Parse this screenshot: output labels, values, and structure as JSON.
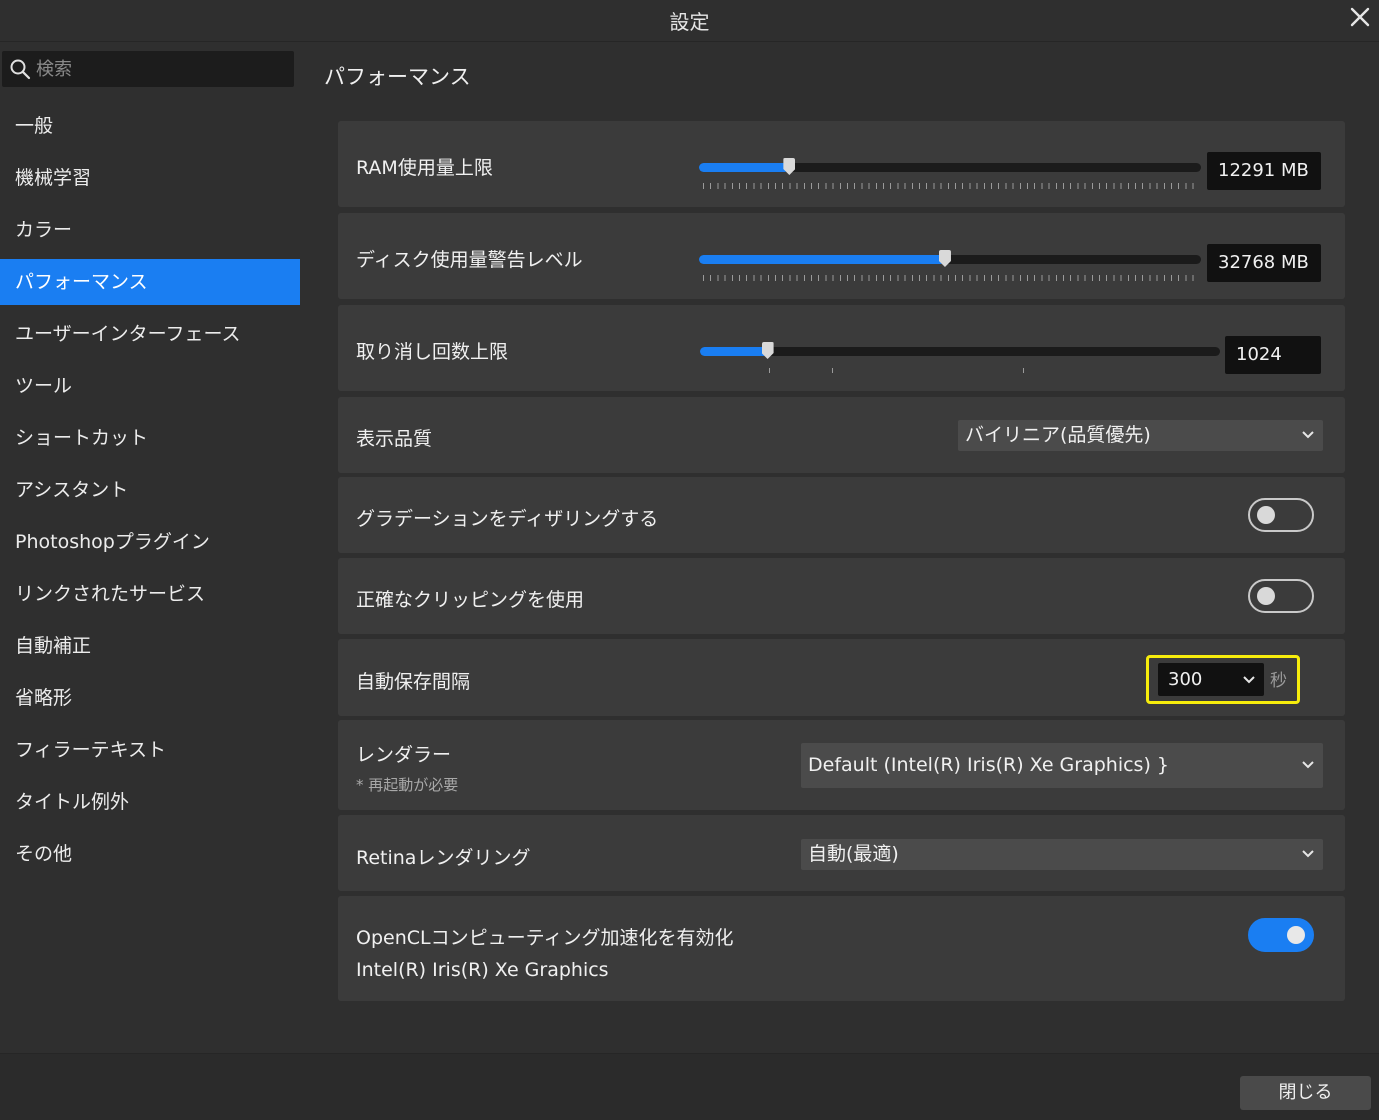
{
  "window": {
    "title": "設定"
  },
  "search": {
    "placeholder": "検索"
  },
  "sidebar": {
    "items": [
      {
        "label": "一般"
      },
      {
        "label": "機械学習"
      },
      {
        "label": "カラー"
      },
      {
        "label": "パフォーマンス",
        "active": true
      },
      {
        "label": "ユーザーインターフェース"
      },
      {
        "label": "ツール"
      },
      {
        "label": "ショートカット"
      },
      {
        "label": "アシスタント"
      },
      {
        "label": "Photoshopプラグイン"
      },
      {
        "label": "リンクされたサービス"
      },
      {
        "label": "自動補正"
      },
      {
        "label": "省略形"
      },
      {
        "label": "フィラーテキスト"
      },
      {
        "label": "タイトル例外"
      },
      {
        "label": "その他"
      }
    ]
  },
  "main": {
    "section_title": "パフォーマンス",
    "ram_limit": {
      "label": "RAM使用量上限",
      "value": "12291 MB",
      "fill_fraction": 0.18
    },
    "disk_warning": {
      "label": "ディスク使用量警告レベル",
      "value": "32768 MB",
      "fill_fraction": 0.49
    },
    "undo_limit": {
      "label": "取り消し回数上限",
      "value": "1024",
      "fill_fraction": 0.13
    },
    "display_quality": {
      "label": "表示品質",
      "value": "バイリニア(品質優先)"
    },
    "dither_gradients": {
      "label": "グラデーションをディザリングする",
      "enabled": false
    },
    "precise_clipping": {
      "label": "正確なクリッピングを使用",
      "enabled": false
    },
    "autosave_interval": {
      "label": "自動保存間隔",
      "value": "300",
      "unit": "秒"
    },
    "renderer": {
      "label": "レンダラー",
      "note": "* 再起動が必要",
      "value": "Default (Intel(R) Iris(R) Xe Graphics)"
    },
    "retina_rendering": {
      "label": "Retinaレンダリング",
      "value": "自動(最適)"
    },
    "opencl": {
      "label": "OpenCLコンピューティング加速化を有効化",
      "device": "Intel(R) Iris(R) Xe Graphics",
      "enabled": true
    }
  },
  "footer": {
    "close_label": "閉じる"
  },
  "colors": {
    "accent": "#1a7ef2",
    "highlight": "#f6ec0c",
    "panel": "#3b3b3b",
    "background": "#2f2f2f"
  }
}
